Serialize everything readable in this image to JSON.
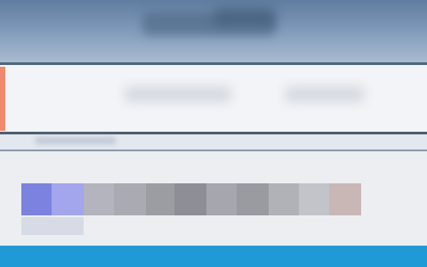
{
  "window": {
    "title": ""
  },
  "address_bar": {
    "value": "",
    "placeholder": "",
    "accent_color": "#f08a6c"
  },
  "content": {
    "label": "",
    "tiles": [
      {
        "icon": "selected-item-icon",
        "color": "#7b82e0"
      },
      {
        "icon": "selected-item-icon",
        "color": "#a3a6ec"
      },
      {
        "icon": "blurred-item",
        "color": "#b3b4bd"
      },
      {
        "icon": "blurred-item",
        "color": "#a9aab2"
      },
      {
        "icon": "blurred-item",
        "color": "#9c9ca3"
      },
      {
        "icon": "blurred-item",
        "color": "#8e8f96"
      },
      {
        "icon": "blurred-item",
        "color": "#a6a7ae"
      },
      {
        "icon": "blurred-item",
        "color": "#9a9aa1"
      },
      {
        "icon": "blurred-item",
        "color": "#b1b2b8"
      },
      {
        "icon": "blurred-item",
        "color": "#c3c4c9"
      },
      {
        "icon": "blurred-item",
        "color": "#c9b7b6"
      }
    ]
  },
  "colors": {
    "header": "#7d98b8",
    "taskbar": "#1f9ad6",
    "separator": "#4c5f72"
  }
}
